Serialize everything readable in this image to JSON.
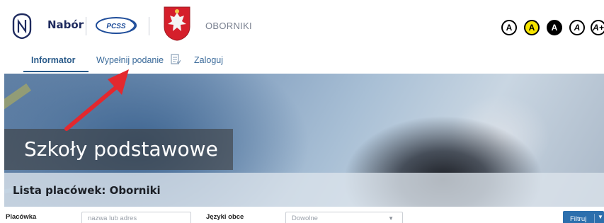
{
  "header": {
    "brand": "Nabór",
    "partner_logo_text": "PCSS",
    "city": "OBORNIKI",
    "contrast_buttons": [
      "A",
      "A",
      "A",
      "A",
      "A+"
    ]
  },
  "nav": {
    "items": [
      {
        "label": "Informator",
        "active": true
      },
      {
        "label": "Wypełnij podanie",
        "active": false
      },
      {
        "label": "Zaloguj",
        "active": false
      }
    ]
  },
  "banner": {
    "title": "Szkoły podstawowe",
    "list_title": "Lista placówek: Oborniki"
  },
  "filters": {
    "placowka_label": "Placówka",
    "placowka_placeholder": "nazwa lub adres",
    "jezyki_label": "Języki obce",
    "jezyki_value": "Dowolne",
    "filter_button": "Filtruj"
  },
  "colors": {
    "brand_dark": "#1e2a5e",
    "nav_link": "#3a6a9a",
    "button_blue": "#2c6fad",
    "arrow_red": "#e3282e",
    "contrast_yellow": "#f6e400"
  },
  "icons": {
    "brand_logo": "nabor-shield-logo",
    "partner_logo": "pcss-logo",
    "city_crest": "oborniki-crest",
    "form_icon": "form-document-icon",
    "annotation": "red-arrow"
  }
}
